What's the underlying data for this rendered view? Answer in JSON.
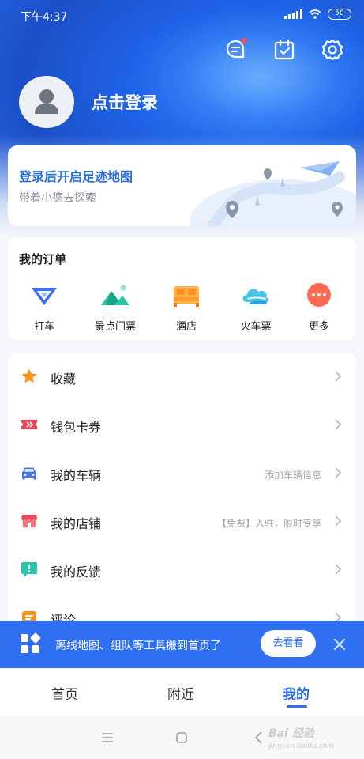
{
  "status_bar": {
    "time": "下午4:37",
    "battery": "50"
  },
  "header": {
    "login_label": "点击登录"
  },
  "footprint": {
    "title": "登录后开启足迹地图",
    "subtitle": "带着小德去探索"
  },
  "orders": {
    "title": "我的订单",
    "items": [
      {
        "label": "打车",
        "icon": "taxi-icon"
      },
      {
        "label": "景点门票",
        "icon": "mountain-icon"
      },
      {
        "label": "酒店",
        "icon": "bed-icon"
      },
      {
        "label": "火车票",
        "icon": "cloud-icon"
      },
      {
        "label": "更多",
        "icon": "more-icon"
      }
    ]
  },
  "menu": [
    {
      "label": "收藏",
      "hint": "",
      "icon": "star-icon"
    },
    {
      "label": "钱包卡券",
      "hint": "",
      "icon": "ticket-icon"
    },
    {
      "label": "我的车辆",
      "hint": "添加车辆信息",
      "icon": "car-icon"
    },
    {
      "label": "我的店铺",
      "hint": "【免费】入驻，限时专享",
      "icon": "shop-icon"
    },
    {
      "label": "我的反馈",
      "hint": "",
      "icon": "feedback-icon"
    },
    {
      "label": "评论",
      "hint": "",
      "icon": "comment-icon"
    }
  ],
  "banner": {
    "text": "离线地图、组队等工具搬到首页了",
    "button": "去看看"
  },
  "tabs": [
    {
      "label": "首页"
    },
    {
      "label": "附近"
    },
    {
      "label": "我的"
    }
  ],
  "watermark": {
    "brand": "Bai 经验",
    "url": "jingyan.baidu.com"
  },
  "colors": {
    "primary": "#2f6ff2",
    "title_blue": "#2a6fe0",
    "star": "#f7941d",
    "ticket": "#f0485a",
    "shop": "#f0485a",
    "feedback": "#2cc4a8"
  }
}
